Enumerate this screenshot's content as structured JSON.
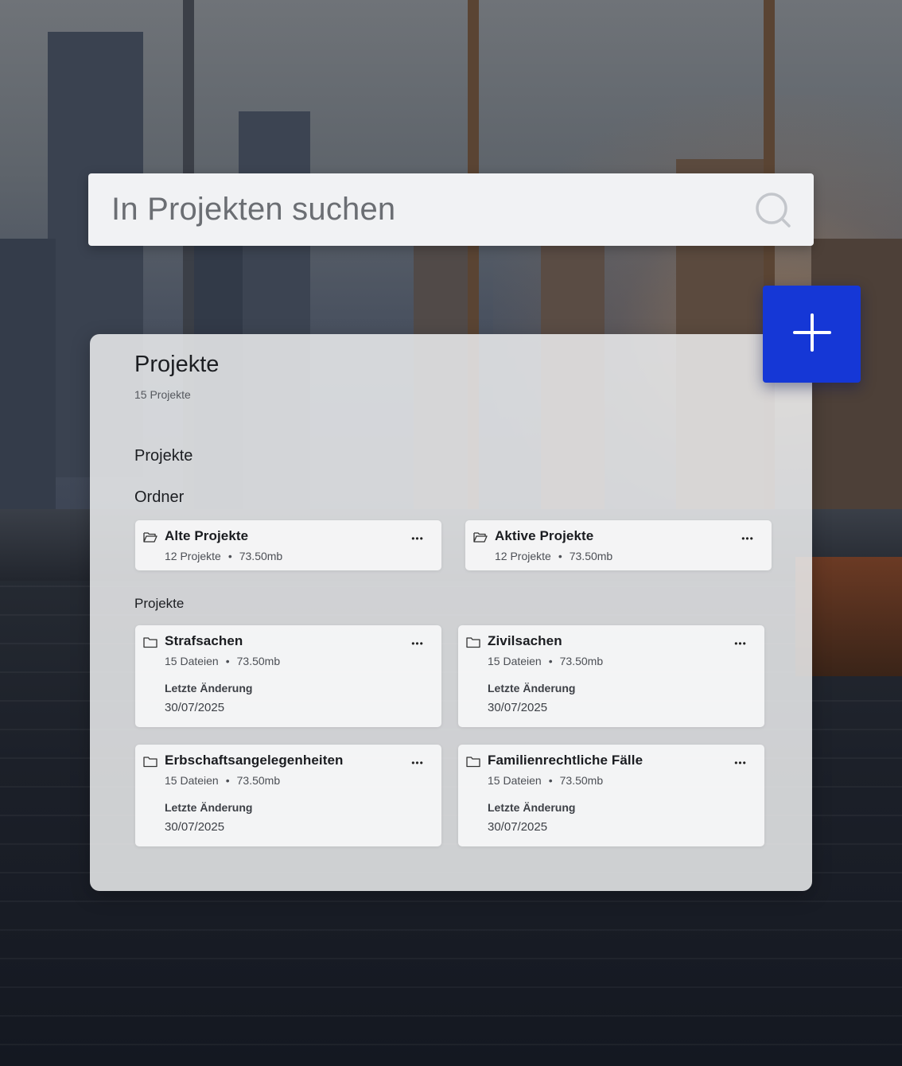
{
  "search": {
    "placeholder": "In Projekten suchen",
    "icon": "search-icon"
  },
  "add_button": {
    "icon": "plus-icon",
    "color": "#1537d6"
  },
  "panel": {
    "title": "Projekte",
    "subtitle": "15 Projekte",
    "nav": {
      "projekte": "Projekte",
      "ordner": "Ordner"
    },
    "folders": [
      {
        "name": "Alte Projekte",
        "count": "12 Projekte",
        "size": "73.50mb",
        "icon": "folder-open-icon"
      },
      {
        "name": "Aktive Projekte",
        "count": "12 Projekte",
        "size": "73.50mb",
        "icon": "folder-open-icon"
      }
    ],
    "projects_heading": "Projekte",
    "projects": [
      {
        "name": "Strafsachen",
        "files": "15 Dateien",
        "size": "73.50mb",
        "change_label": "Letzte Änderung",
        "date": "30/07/2025",
        "icon": "folder-icon"
      },
      {
        "name": "Zivilsachen",
        "files": "15 Dateien",
        "size": "73.50mb",
        "change_label": "Letzte Änderung",
        "date": "30/07/2025",
        "icon": "folder-icon"
      },
      {
        "name": "Erbschaftsangelegenheiten",
        "files": "15 Dateien",
        "size": "73.50mb",
        "change_label": "Letzte Änderung",
        "date": "30/07/2025",
        "icon": "folder-icon"
      },
      {
        "name": "Familienrechtliche Fälle",
        "files": "15 Dateien",
        "size": "73.50mb",
        "change_label": "Letzte Änderung",
        "date": "30/07/2025",
        "icon": "folder-icon"
      }
    ],
    "more_icon": "more-horizontal-icon",
    "separator": "•"
  }
}
